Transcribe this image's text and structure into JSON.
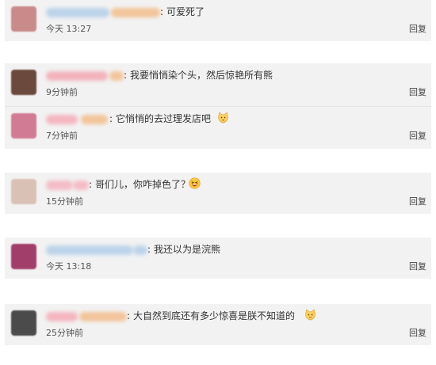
{
  "separator": ":",
  "comments": [
    {
      "text": "可爱死了",
      "time": "今天 13:27",
      "reply": "回复",
      "avatar_color": "#c98a8a",
      "name_color": "#bcd3ea",
      "name_accent": "#f2c59a"
    },
    {
      "text": "我要悄悄染个头，然后惊艳所有熊",
      "time": "9分钟前",
      "reply": "回复",
      "avatar_color": "#6b4a3d",
      "name_color": "#f2b3bd",
      "name_accent": "#f2c59a"
    },
    {
      "text": "它悄悄的去过理发店吧",
      "time": "7分钟前",
      "reply": "回复",
      "avatar_color": "#d27b95",
      "name_color": "#f4b6c0",
      "name_accent": "#f2c59a",
      "emoji": "cat-face-emoji"
    },
    {
      "text": "哥们儿，你咋掉色了？",
      "time": "15分钟前",
      "reply": "回复",
      "avatar_color": "#d9c2b5",
      "name_color": "#f4bcc6",
      "name_accent": "#f4bcc6",
      "emoji": "laughing-face-emoji"
    },
    {
      "text": "我还以为是浣熊",
      "time": "今天 13:18",
      "reply": "回复",
      "avatar_color": "#a23e6a",
      "name_color": "#bcd3ea",
      "name_accent": "#bcd3ea"
    },
    {
      "text": "大自然到底还有多少惊喜是朕不知道的",
      "time": "25分钟前",
      "reply": "回复",
      "avatar_color": "#4b4b4b",
      "name_color": "#f4b6c0",
      "name_accent": "#f2c59a",
      "emoji": "cat-face-emoji"
    }
  ]
}
